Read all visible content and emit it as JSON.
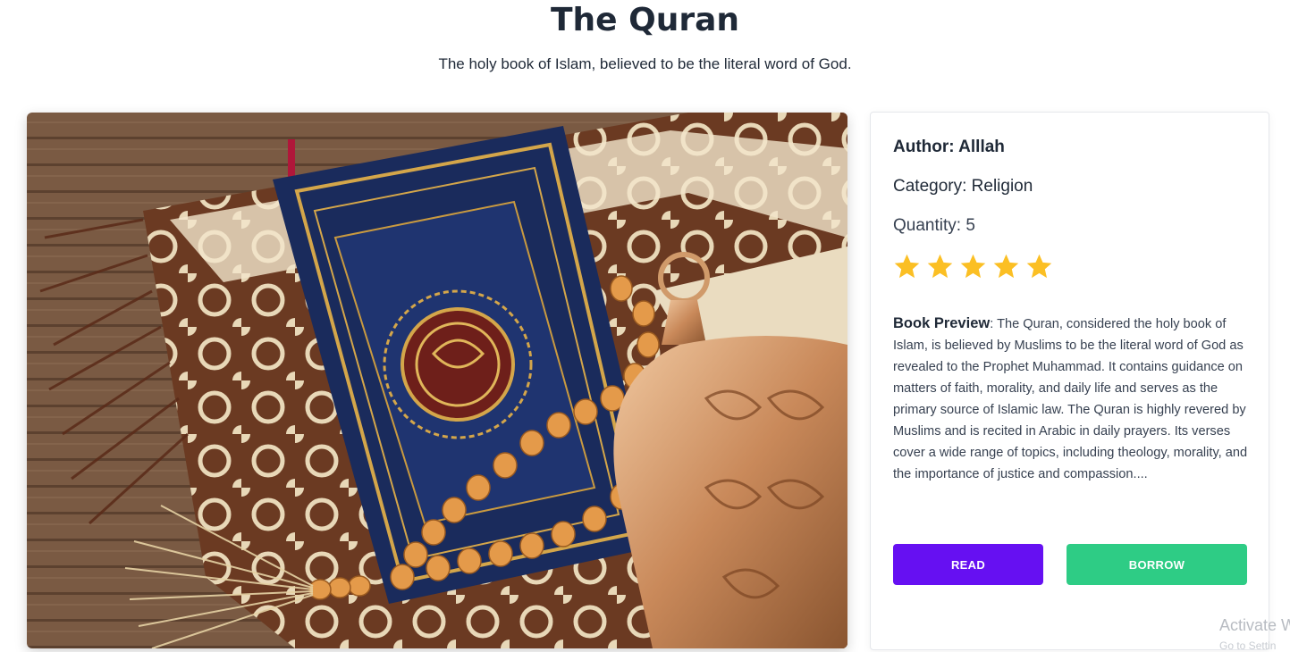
{
  "page": {
    "title": "The Quran",
    "subtitle": "The holy book of Islam, believed to be the literal word of God."
  },
  "book": {
    "image_icon": "book-cover-photo",
    "author": "Author: Alllah",
    "category": "Category: Religion",
    "quantity": "Quantity: 5",
    "rating": 5,
    "rating_max": 5,
    "star_color": "#fbbf24",
    "preview_label": "Book Preview",
    "preview_text": ": The Quran, considered the holy book of Islam, is believed by Muslims to be the literal word of God as revealed to the Prophet Muhammad. It contains guidance on matters of faith, morality, and daily life and serves as the primary source of Islamic law. The Quran is highly revered by Muslims and is recited in Arabic in daily prayers. Its verses cover a wide range of topics, including theology, morality, and the importance of justice and compassion...."
  },
  "actions": {
    "read_label": "READ",
    "read_color": "#6610f2",
    "borrow_label": "BORROW",
    "borrow_color": "#2ecc85"
  },
  "system": {
    "watermark": "Activate W",
    "watermark_sub": "Go to Settin"
  }
}
